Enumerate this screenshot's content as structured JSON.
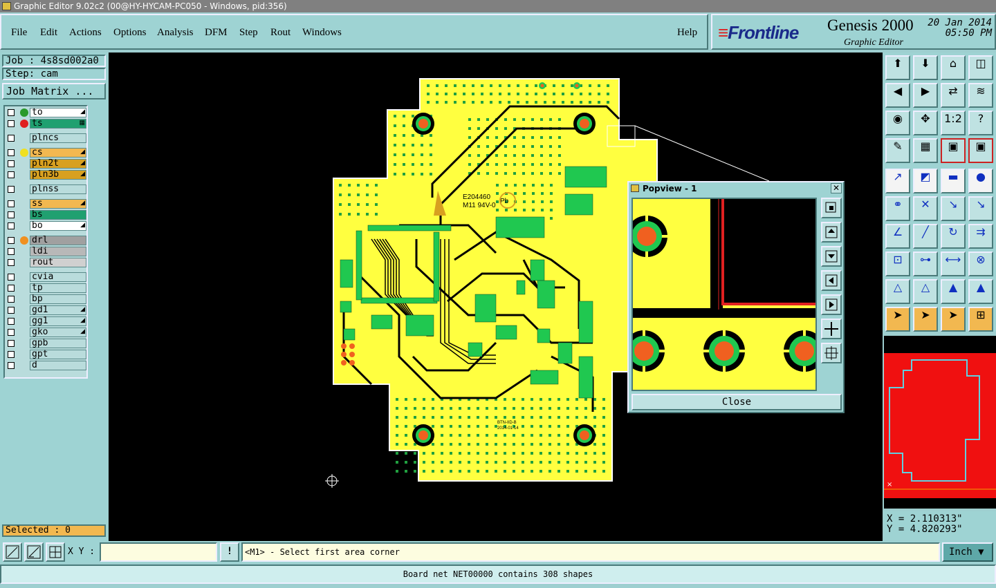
{
  "window": {
    "title": "Graphic Editor 9.02c2 (00@HY-HYCAM-PC050 - Windows, pid:356)"
  },
  "menu": [
    "File",
    "Edit",
    "Actions",
    "Options",
    "Analysis",
    "DFM",
    "Step",
    "Rout",
    "Windows"
  ],
  "help_label": "Help",
  "brand": {
    "logo": "Frontline",
    "product": "Genesis 2000",
    "subtitle": "Graphic Editor",
    "date": "20 Jan 2014",
    "time": "05:50 PM"
  },
  "job": {
    "job_label": "Job : 4s8sd002a0",
    "step_label": "Step: cam",
    "matrix_button": "Job Matrix ..."
  },
  "layers": [
    {
      "name": "to",
      "dot": "#2a9a2a",
      "bg": "#ffffff",
      "mark": "◢"
    },
    {
      "name": "ts",
      "dot": "#e02020",
      "bg": "#20a070",
      "mark": "▦"
    },
    {
      "name": "plncs",
      "dot": "",
      "bg": "#b9dcdc",
      "mark": ""
    },
    {
      "name": "cs",
      "dot": "#f0e020",
      "bg": "#f2b850",
      "mark": "◢"
    },
    {
      "name": "pln2t",
      "dot": "",
      "bg": "#d8a020",
      "mark": "◢"
    },
    {
      "name": "pln3b",
      "dot": "",
      "bg": "#d8a020",
      "mark": "◢"
    },
    {
      "name": "plnss",
      "dot": "",
      "bg": "#b9dcdc",
      "mark": ""
    },
    {
      "name": "ss",
      "dot": "",
      "bg": "#f2b850",
      "mark": "◢"
    },
    {
      "name": "bs",
      "dot": "",
      "bg": "#20a070",
      "mark": ""
    },
    {
      "name": "bo",
      "dot": "",
      "bg": "#ffffff",
      "mark": "◢"
    },
    {
      "name": "drl",
      "dot": "#f09020",
      "bg": "#a0a0a0",
      "mark": ""
    },
    {
      "name": "ldi",
      "dot": "",
      "bg": "#b8b8b8",
      "mark": ""
    },
    {
      "name": "rout",
      "dot": "",
      "bg": "#d0d0d0",
      "mark": ""
    },
    {
      "name": "cvia",
      "dot": "",
      "bg": "#b9dcdc",
      "mark": ""
    },
    {
      "name": "tp",
      "dot": "",
      "bg": "#b9dcdc",
      "mark": ""
    },
    {
      "name": "bp",
      "dot": "",
      "bg": "#b9dcdc",
      "mark": ""
    },
    {
      "name": "gd1",
      "dot": "",
      "bg": "#b9dcdc",
      "mark": "◢"
    },
    {
      "name": "gg1",
      "dot": "",
      "bg": "#b9dcdc",
      "mark": "◢"
    },
    {
      "name": "gko",
      "dot": "",
      "bg": "#b9dcdc",
      "mark": "◢"
    },
    {
      "name": "gpb",
      "dot": "",
      "bg": "#b9dcdc",
      "mark": ""
    },
    {
      "name": "gpt",
      "dot": "",
      "bg": "#b9dcdc",
      "mark": ""
    },
    {
      "name": "d",
      "dot": "",
      "bg": "#b9dcdc",
      "mark": ""
    }
  ],
  "selected_label": "Selected : 0",
  "popview": {
    "title": "Popview - 1",
    "close_label": "Close"
  },
  "coords": {
    "x": "X = 2.110313\"",
    "y": "Y = 4.820293\""
  },
  "bottom": {
    "xy_label": "X Y :",
    "xy_value": "",
    "prompt": "<M1> - Select first area corner",
    "units": "Inch",
    "bang": "!"
  },
  "status": "Board net NET00000 contains 308 shapes",
  "board_text": {
    "ul_code": "E204460",
    "rating": "M11 94V-0",
    "pb": "Pb",
    "part": "BTN-IID-B",
    "datecode": "2014-01-14"
  },
  "colors": {
    "board": "#ffff40",
    "pad": "#20d050",
    "drill": "#f06020",
    "trace": "#000000",
    "outline": "#e02020",
    "outline_cyan": "#60d0e0"
  }
}
